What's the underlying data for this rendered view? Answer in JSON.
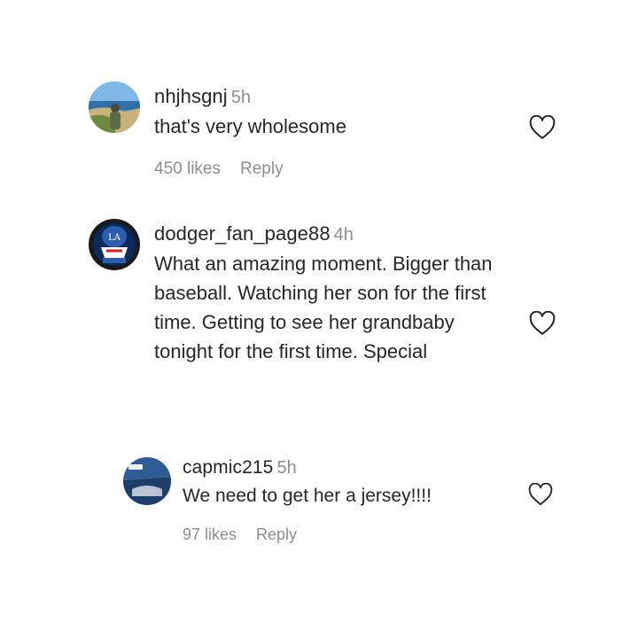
{
  "comments": [
    {
      "username": "nhjhsgnj",
      "time": "5h",
      "text": "that's very wholesome",
      "likes": "450 likes",
      "reply": "Reply",
      "avatar": "beach-scene-avatar"
    },
    {
      "username": "dodger_fan_page88",
      "time": "4h",
      "text": "What an amazing moment. Bigger than baseball. Watching her son for the first time. Getting to see her grandbaby tonight for the first time. Special",
      "avatar": "dodgers-logo-avatar"
    },
    {
      "username": "capmic215",
      "time": "5h",
      "text": "We need to get her a jersey!!!!",
      "likes": "97 likes",
      "reply": "Reply",
      "avatar": "blue-cap-avatar"
    }
  ],
  "icons": {
    "like": "heart-outline-icon"
  },
  "colors": {
    "text": "#262626",
    "muted": "#8e8e8e",
    "background": "#ffffff"
  }
}
